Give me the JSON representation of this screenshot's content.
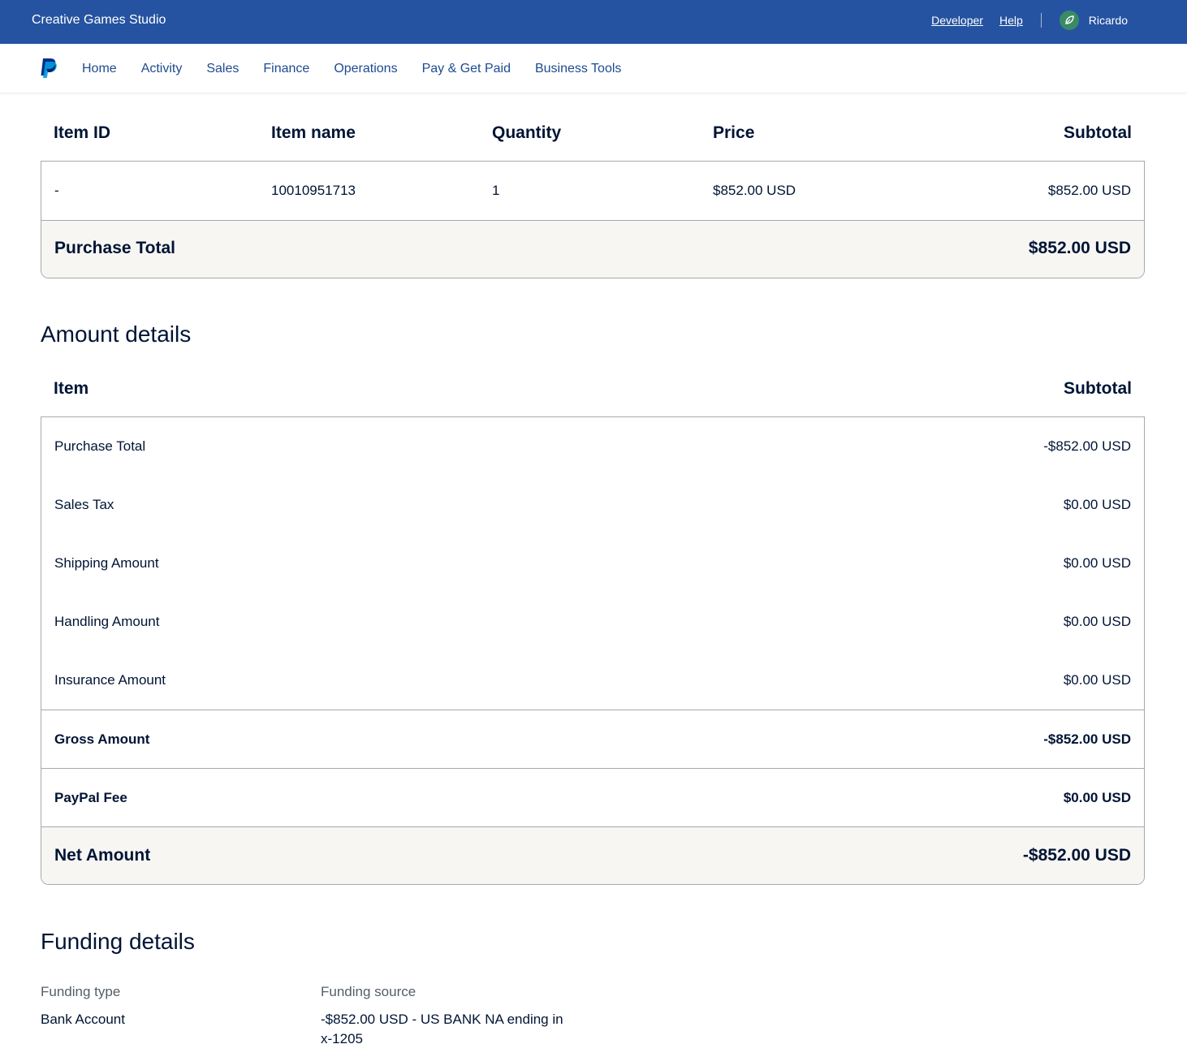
{
  "topbar": {
    "studio": "Creative Games Studio",
    "developer_link": "Developer",
    "help_link": "Help",
    "username": "Ricardo"
  },
  "nav": {
    "items": [
      "Home",
      "Activity",
      "Sales",
      "Finance",
      "Operations",
      "Pay & Get Paid",
      "Business Tools"
    ]
  },
  "items_table": {
    "headers": {
      "item_id": "Item ID",
      "item_name": "Item name",
      "quantity": "Quantity",
      "price": "Price",
      "subtotal": "Subtotal"
    },
    "rows": [
      {
        "item_id": "-",
        "item_name": "10010951713",
        "quantity": "1",
        "price": "$852.00 USD",
        "subtotal": "$852.00 USD"
      }
    ],
    "total_label": "Purchase Total",
    "total_value": "$852.00 USD"
  },
  "amount_details": {
    "title": "Amount details",
    "headers": {
      "item": "Item",
      "subtotal": "Subtotal"
    },
    "rows": [
      {
        "label": "Purchase Total",
        "value": "-$852.00 USD"
      },
      {
        "label": "Sales Tax",
        "value": "$0.00 USD"
      },
      {
        "label": "Shipping Amount",
        "value": "$0.00 USD"
      },
      {
        "label": "Handling Amount",
        "value": "$0.00 USD"
      },
      {
        "label": "Insurance Amount",
        "value": "$0.00 USD"
      }
    ],
    "gross": {
      "label": "Gross Amount",
      "value": "-$852.00 USD"
    },
    "fee": {
      "label": "PayPal Fee",
      "value": "$0.00 USD"
    },
    "net": {
      "label": "Net Amount",
      "value": "-$852.00 USD"
    }
  },
  "funding_details": {
    "title": "Funding details",
    "type_label": "Funding type",
    "type_value": "Bank Account",
    "source_label": "Funding source",
    "source_line1": "-$852.00 USD - US BANK NA ending in",
    "source_line2": "x-1205"
  },
  "colors": {
    "topbar_bg": "#2553a1",
    "nav_link": "#1e4a91",
    "text_dark": "#001435",
    "total_row_bg": "#f7f6f3"
  }
}
